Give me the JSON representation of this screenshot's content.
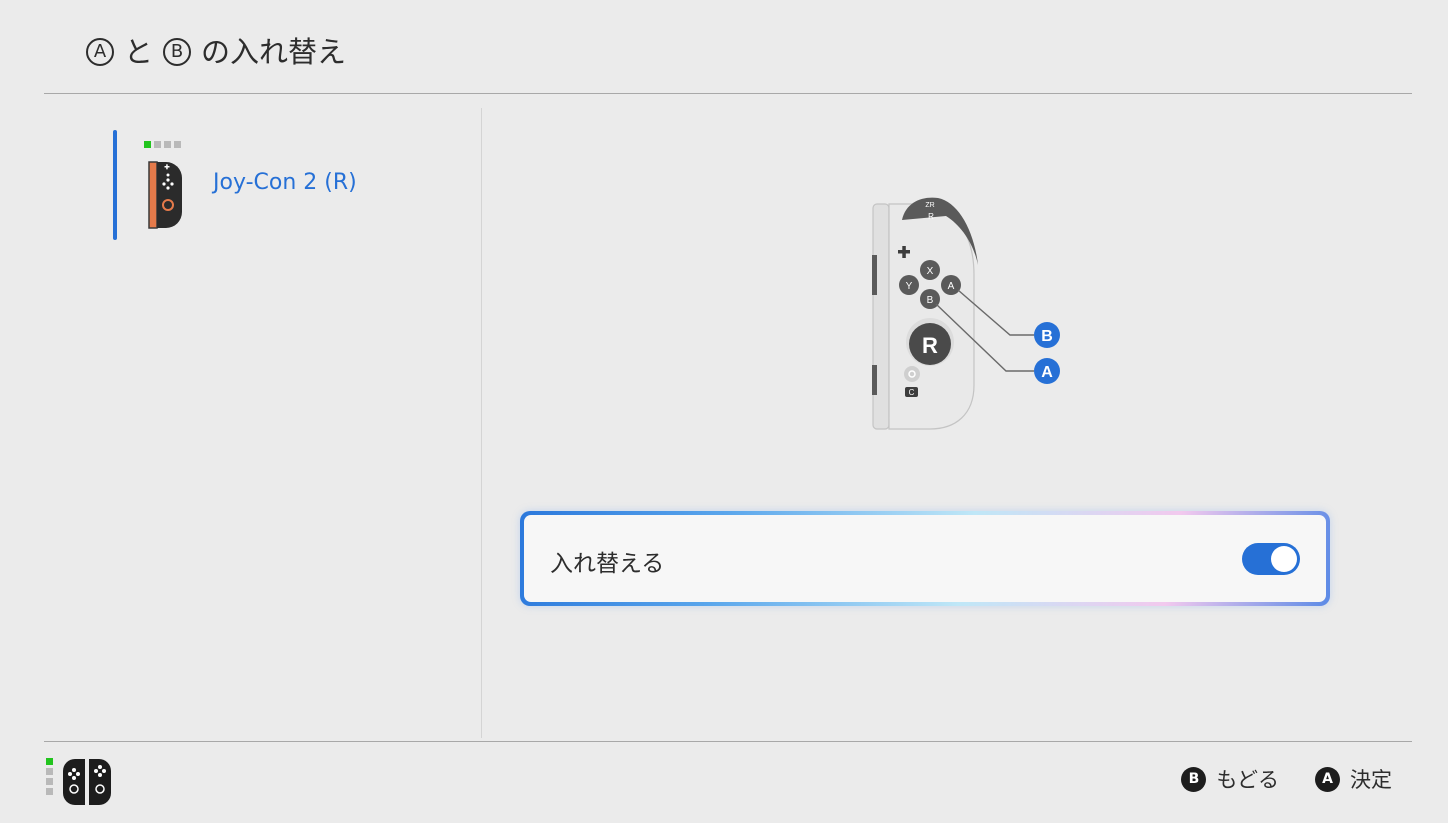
{
  "header": {
    "title_btn_a": "A",
    "title_conj": "と",
    "title_btn_b": "B",
    "title_suffix": "の入れ替え"
  },
  "sidebar": {
    "items": [
      {
        "label": "Joy-Con 2 (R)",
        "player_indicator": [
          true,
          false,
          false,
          false
        ],
        "selected": true
      }
    ]
  },
  "diagram": {
    "buttons": {
      "x": "X",
      "y": "Y",
      "a": "A",
      "b": "B",
      "zr": "ZR",
      "r_shoulder": "R",
      "stick": "R",
      "c": "C"
    },
    "callouts": [
      {
        "label": "B"
      },
      {
        "label": "A"
      }
    ]
  },
  "setting": {
    "label": "入れ替える",
    "enabled": true
  },
  "footer": {
    "back": {
      "button": "B",
      "label": "もどる"
    },
    "confirm": {
      "button": "A",
      "label": "決定"
    }
  },
  "colors": {
    "accent": "#2670d6",
    "player_led_on": "#22c41e",
    "joycon_rail": "#e57a4a"
  }
}
